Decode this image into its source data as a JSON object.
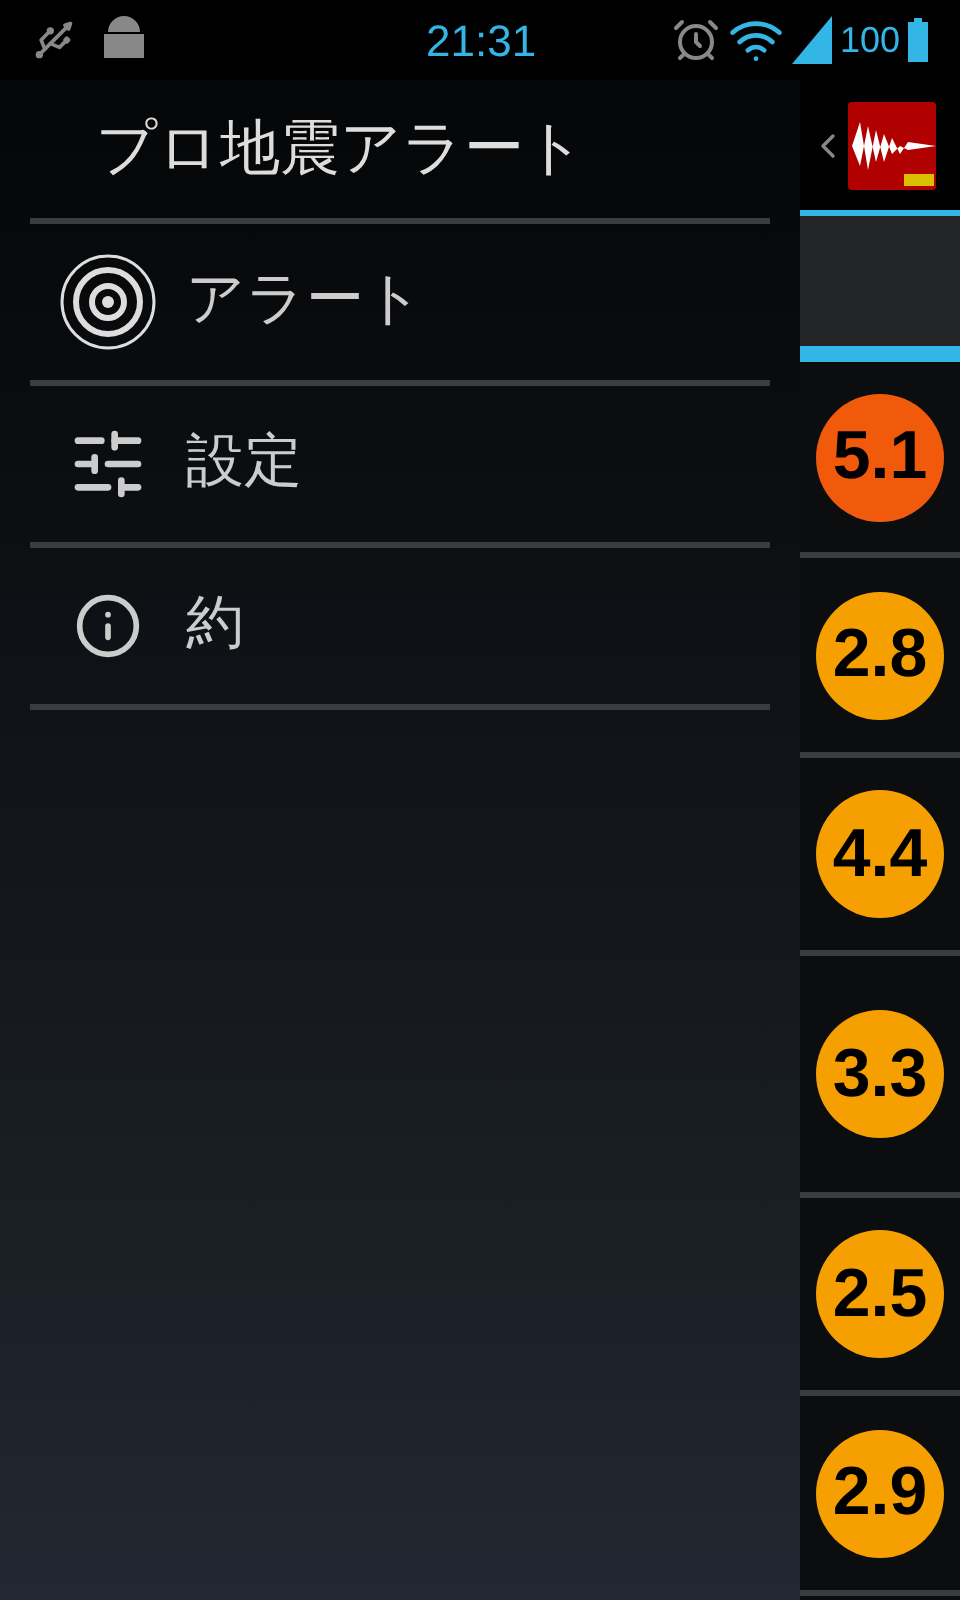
{
  "status_bar": {
    "time": "21:31",
    "battery": "100"
  },
  "drawer": {
    "title": "プロ地震アラート",
    "items": [
      {
        "label": "アラート",
        "kind": "alerts"
      },
      {
        "label": "設定",
        "kind": "settings"
      },
      {
        "label": "約",
        "kind": "about"
      }
    ]
  },
  "quakes": [
    {
      "magnitude": "5.1",
      "color": "#f05a0a"
    },
    {
      "magnitude": "2.8",
      "color": "#f5a000"
    },
    {
      "magnitude": "4.4",
      "color": "#f5a000"
    },
    {
      "magnitude": "3.3",
      "color": "#f5a000"
    },
    {
      "magnitude": "2.5",
      "color": "#f5a000"
    },
    {
      "magnitude": "2.9",
      "color": "#f5a000"
    }
  ]
}
